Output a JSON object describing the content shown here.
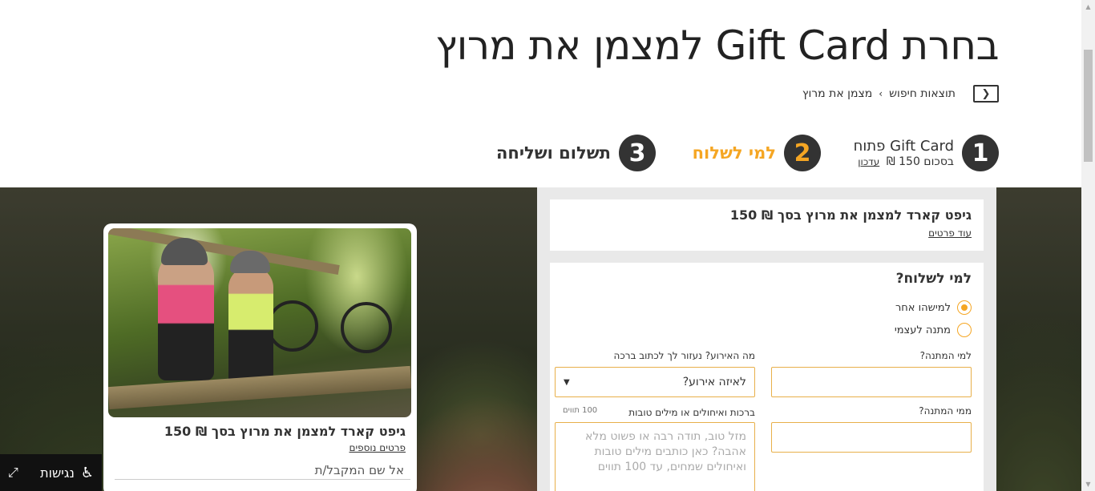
{
  "header": {
    "title": "בחרת Gift Card למצמן את מרוץ",
    "breadcrumb": {
      "back_icon": "chevron-left-icon",
      "items": [
        "תוצאות חיפוש",
        "מצמן את מרוץ"
      ],
      "separator": "›"
    }
  },
  "steps": [
    {
      "number": "1",
      "main": "Gift Card פתוח",
      "sub": "בסכום 150 ₪",
      "link": "עדכון"
    },
    {
      "number": "2",
      "label": "למי לשלוח",
      "active": true
    },
    {
      "number": "3",
      "label": "תשלום ושליחה"
    }
  ],
  "card": {
    "title": "גיפט קארד למצמן את מרוץ בסך ₪ 150",
    "more": "פרטים נוספים",
    "to_label": "אל  שם המקבל/ת"
  },
  "accessibility": {
    "label": "נגישות",
    "icon": "wheelchair-icon",
    "expand_icon": "expand-icon"
  },
  "summary": {
    "title": "גיפט קארד למצמן את מרוץ בסך ₪ 150",
    "more": "עוד פרטים"
  },
  "form": {
    "title": "למי לשלוח?",
    "options": [
      {
        "label": "למישהו אחר",
        "selected": true
      },
      {
        "label": "מתנה לעצמי",
        "selected": false
      }
    ],
    "to_label": "למי המתנה?",
    "to_value": "",
    "from_label": "ממי המתנה?",
    "from_value": "",
    "event_label": "מה האירוע? נעזור לך לכתוב ברכה",
    "event_value": "לאיזה אירוע?",
    "greeting_label": "ברכות ואיחולים או מילים טובות",
    "greeting_counter": "100 תווים",
    "greeting_placeholder": "מזל טוב, תודה רבה או פשוט מלא אהבה? כאן כותבים מילים טובות ואיחולים שמחים, עד 100 תווים"
  },
  "colors": {
    "accent": "#f5a623",
    "dark": "#333333"
  }
}
